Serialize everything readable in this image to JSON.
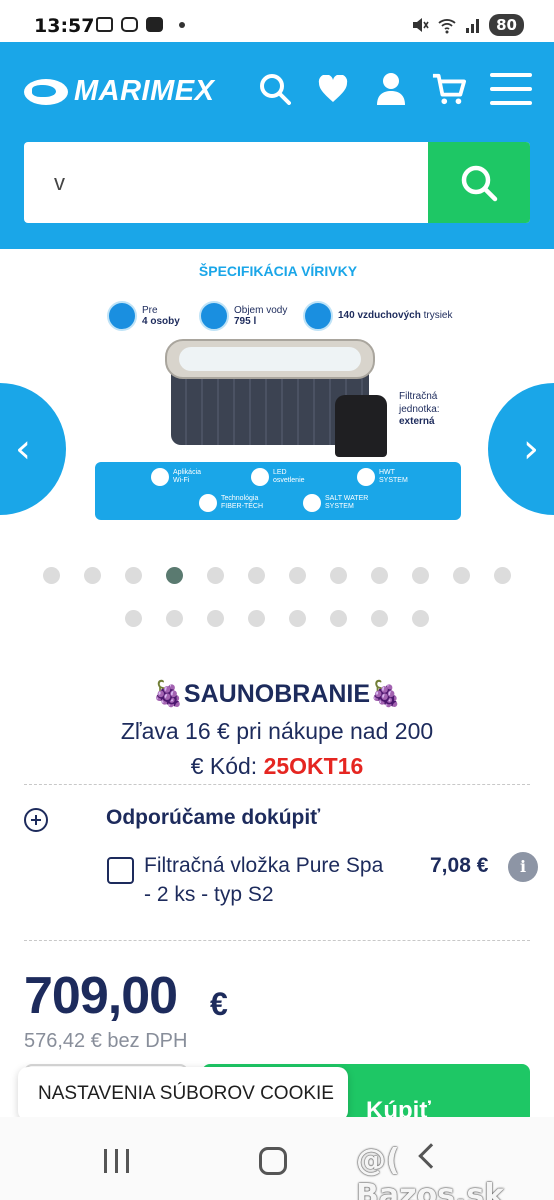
{
  "status_bar": {
    "time": "13:57",
    "battery": "80",
    "icons": [
      "calendar-icon",
      "instagram-icon",
      "youtube-icon",
      "mute-icon",
      "wifi-icon",
      "signal-icon"
    ]
  },
  "header": {
    "logo_text": "MARIMEX",
    "search_value": "v",
    "colors": {
      "brand_blue": "#1aa6e8",
      "green": "#1ec765",
      "navy": "#1d2b5c",
      "red": "#e52621"
    }
  },
  "gallery": {
    "title": "ŠPECIFIKÁCIA VÍRIVKY",
    "features": {
      "persons_label": "Pre",
      "persons_value": "4 osoby",
      "volume_label": "Objem vody",
      "volume_value": "795 l",
      "jets_value": "140 vzduchových",
      "jets_label": "trysiek"
    },
    "filter_label": "Filtračná",
    "filter_label2": "jednotka:",
    "filter_value": "externá",
    "badges": {
      "app_1": "Aplikácia",
      "app_2": "Wi-Fi",
      "led_1": "LED",
      "led_2": "osvetlenie",
      "hwt_1": "HWT",
      "hwt_2": "SYSTEM",
      "fiber_1": "Technológia",
      "fiber_2": "FIBER-TECH",
      "salt_1": "SALT WATER",
      "salt_2": "SYSTEM"
    },
    "prev_arrow": "‹",
    "next_arrow": "›",
    "dots_total": 20,
    "active_dot": 4
  },
  "promo": {
    "title": "🍇SAUNOBRANIE🍇",
    "line1": "Zľava 16 € pri nákupe nad 200",
    "line2_prefix": "€ Kód: ",
    "code": "25OKT16"
  },
  "recommend": {
    "title": "Odporúčame dokúpiť",
    "item_name": "Filtračná vložka Pure Spa - 2 ks - typ S2",
    "item_price": "7,08 €",
    "info": "i"
  },
  "price": {
    "amount": "709,00",
    "currency": "€",
    "net": "576,42 € bez DPH"
  },
  "buy_label": "Kúpiť",
  "cookie_label": "NASTAVENIA SÚBOROV COOKIE",
  "watermark": "@( Bazos.sk"
}
